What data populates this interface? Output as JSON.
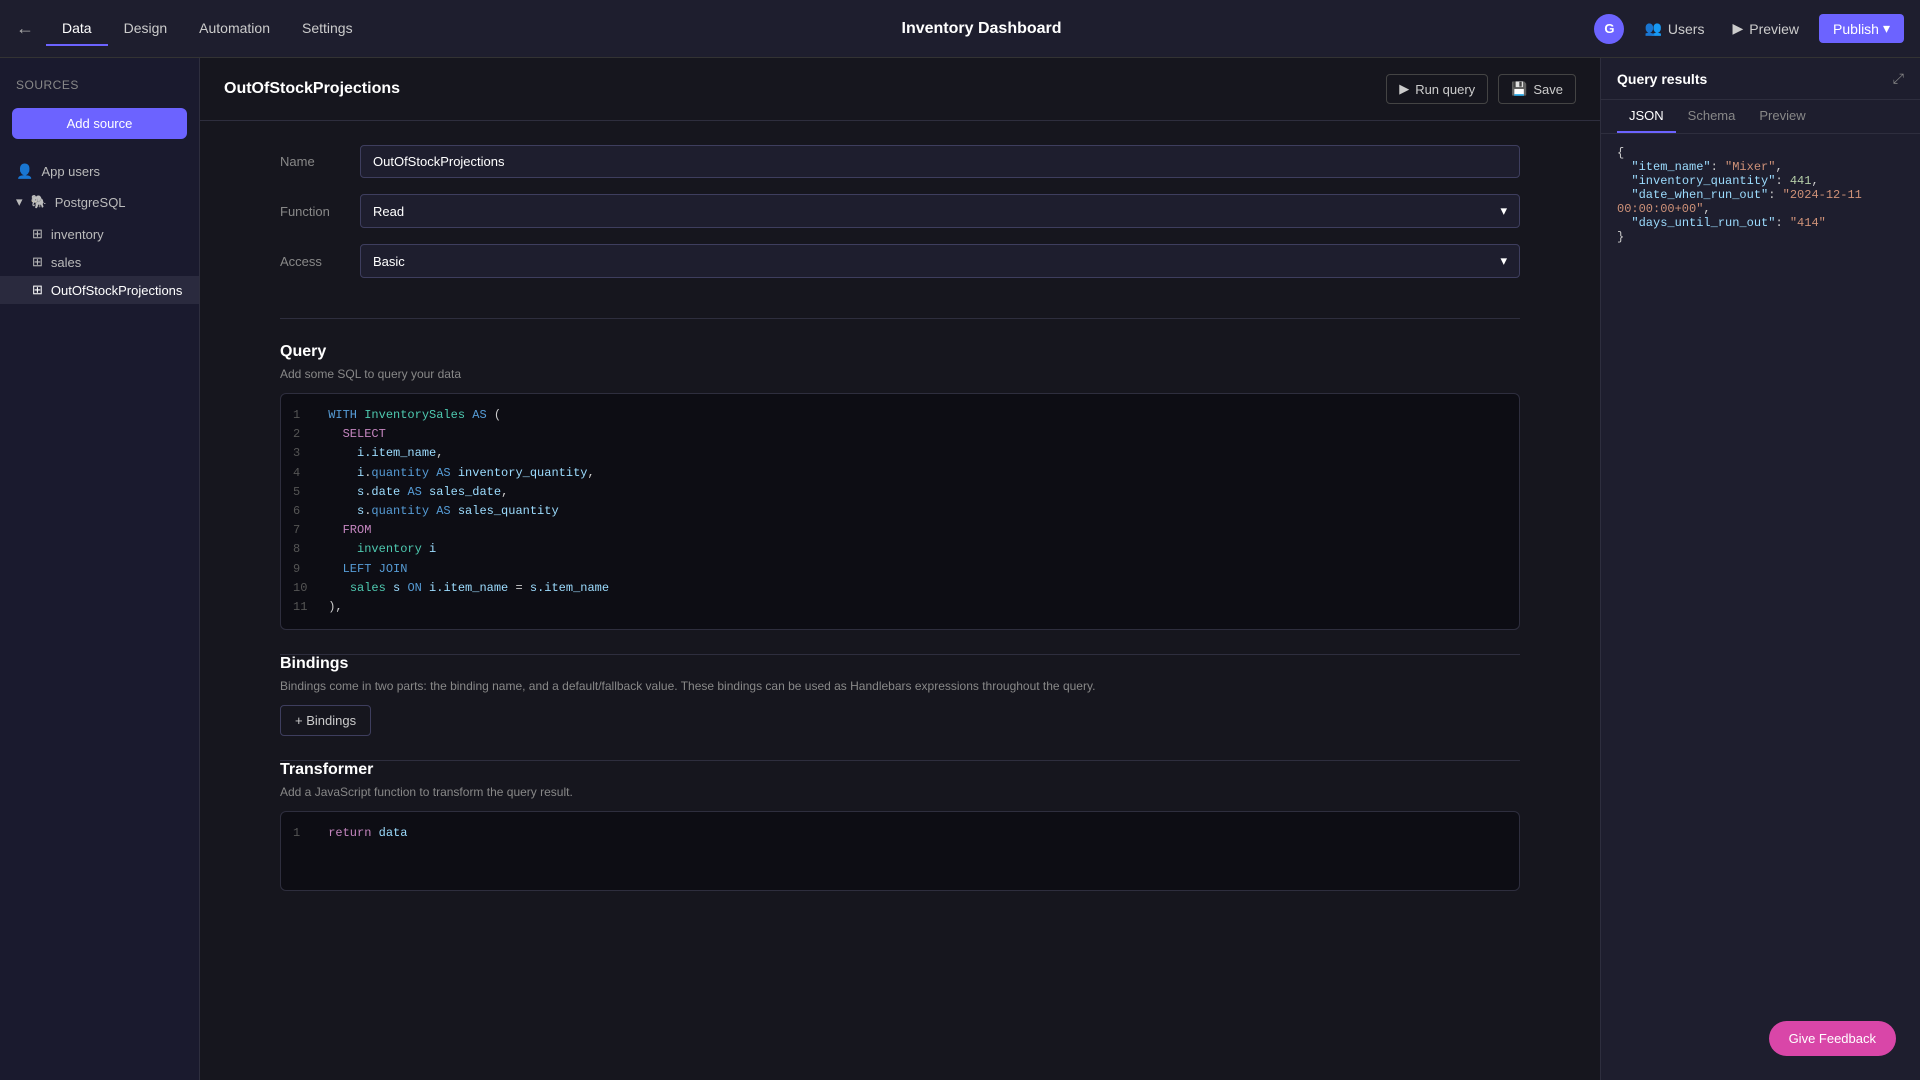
{
  "topbar": {
    "back_icon": "←",
    "tabs": [
      {
        "label": "Data",
        "active": true
      },
      {
        "label": "Design",
        "active": false
      },
      {
        "label": "Automation",
        "active": false
      },
      {
        "label": "Settings",
        "active": false
      }
    ],
    "title": "Inventory Dashboard",
    "avatar_letter": "G",
    "users_label": "Users",
    "preview_label": "Preview",
    "publish_label": "Publish",
    "publish_arrow": "▾"
  },
  "sidebar": {
    "header": "Sources",
    "add_button": "Add source",
    "items": [
      {
        "label": "App users",
        "icon": "👤",
        "type": "users"
      },
      {
        "label": "PostgreSQL",
        "icon": "🐘",
        "type": "db",
        "expanded": true
      },
      {
        "label": "inventory",
        "indent": true
      },
      {
        "label": "sales",
        "indent": true
      },
      {
        "label": "OutOfStockProjections",
        "indent": true,
        "active": true
      }
    ]
  },
  "main": {
    "header_title": "OutOfStockProjections",
    "run_query_label": "Run query",
    "save_label": "Save",
    "name_label": "Name",
    "name_value": "OutOfStockProjections",
    "function_label": "Function",
    "function_value": "Read",
    "access_label": "Access",
    "access_value": "Basic",
    "query_section_title": "Query",
    "query_section_desc": "Add some SQL to query your data",
    "code_lines": [
      {
        "num": 1,
        "code": "WITH InventorySales AS ("
      },
      {
        "num": 2,
        "code": "  SELECT"
      },
      {
        "num": 3,
        "code": "    i.item_name,"
      },
      {
        "num": 4,
        "code": "    i.quantity AS inventory_quantity,"
      },
      {
        "num": 5,
        "code": "    s.date AS sales_date,"
      },
      {
        "num": 6,
        "code": "    s.quantity AS sales_quantity"
      },
      {
        "num": 7,
        "code": "  FROM"
      },
      {
        "num": 8,
        "code": "    inventory i"
      },
      {
        "num": 9,
        "code": "  LEFT JOIN"
      },
      {
        "num": 10,
        "code": "    sales s ON i.item_name = s.item_name"
      },
      {
        "num": 11,
        "code": "),"
      }
    ],
    "bindings_title": "Bindings",
    "bindings_desc": "Bindings come in two parts: the binding name, and a default/fallback value. These bindings can be used as Handlebars expressions throughout the query.",
    "bindings_btn": "+ Bindings",
    "transformer_title": "Transformer",
    "transformer_desc": "Add a JavaScript function to transform the query result.",
    "transformer_code": "return data"
  },
  "results_panel": {
    "title": "Query results",
    "expand_icon": "⤢",
    "tabs": [
      "JSON",
      "Schema",
      "Preview"
    ],
    "active_tab": "JSON",
    "json_content": "{\n  \"item_name\": \"Mixer\",\n  \"inventory_quantity\": 441,\n  \"date_when_run_out\": \"2024-12-11 00:00:00+00\",\n  \"days_until_run_out\": \"414\"\n}"
  },
  "feedback": {
    "label": "Give Feedback"
  }
}
